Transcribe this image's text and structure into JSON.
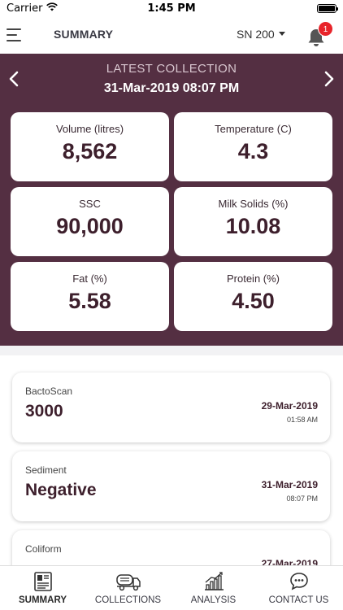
{
  "status_bar": {
    "carrier": "Carrier",
    "time": "1:45 PM"
  },
  "header": {
    "title": "SUMMARY",
    "site_selector": "SN 200",
    "notification_count": "1"
  },
  "latest": {
    "label": "LATEST COLLECTION",
    "datetime": "31-Mar-2019 08:07 PM",
    "metrics": [
      {
        "label": "Volume (litres)",
        "value": "8,562"
      },
      {
        "label": "Temperature (C)",
        "value": "4.3"
      },
      {
        "label": "SSC",
        "value": "90,000"
      },
      {
        "label": "Milk Solids (%)",
        "value": "10.08"
      },
      {
        "label": "Fat (%)",
        "value": "5.58"
      },
      {
        "label": "Protein (%)",
        "value": "4.50"
      }
    ]
  },
  "results": [
    {
      "name": "BactoScan",
      "value": "3000",
      "date": "29-Mar-2019",
      "time": "01:58 AM"
    },
    {
      "name": "Sediment",
      "value": "Negative",
      "date": "31-Mar-2019",
      "time": "08:07 PM"
    },
    {
      "name": "Coliform",
      "value": "",
      "date": "27-Mar-2019",
      "time": ""
    }
  ],
  "tabs": [
    {
      "label": "SUMMARY",
      "icon": "summary-icon",
      "active": true
    },
    {
      "label": "COLLECTIONS",
      "icon": "milk-tanker-icon",
      "active": false
    },
    {
      "label": "ANALYSIS",
      "icon": "bar-chart-icon",
      "active": false
    },
    {
      "label": "CONTACT US",
      "icon": "chat-bubble-icon",
      "active": false
    }
  ],
  "colors": {
    "panel": "#542f42",
    "accent_text": "#3d1f2c",
    "badge": "#e8242a"
  }
}
